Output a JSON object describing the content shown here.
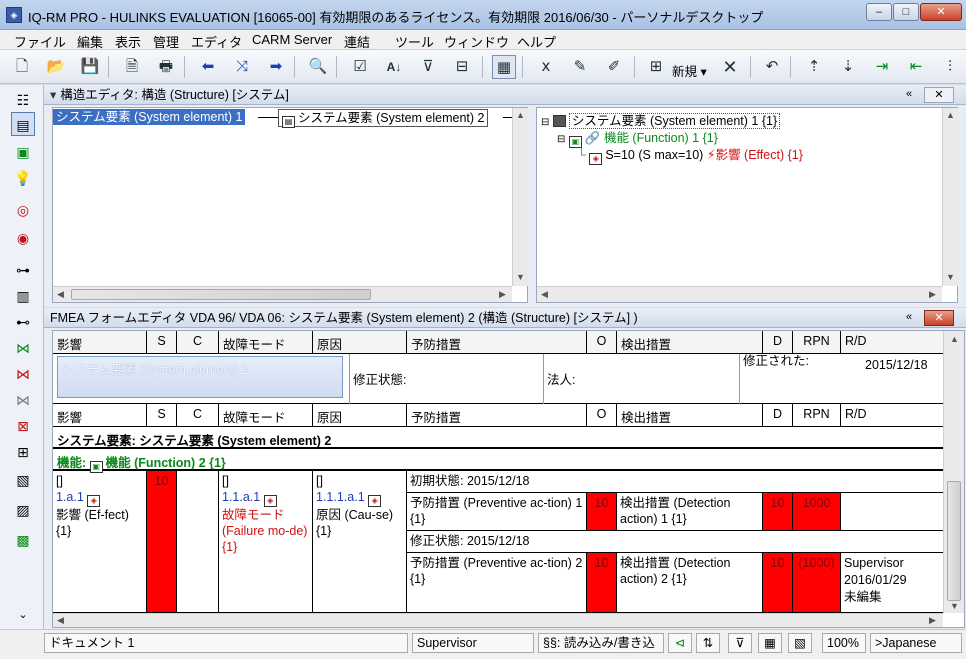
{
  "window": {
    "title": "IQ-RM PRO - HULINKS EVALUATION [16065-00] 有効期限のあるライセンス。有効期限 2016/06/30 - パーソナルデスクトップ",
    "minimize": "–",
    "maximize": "□",
    "close": "✕"
  },
  "menu": [
    "ファイル",
    "編集",
    "表示",
    "管理",
    "エディタ",
    "CARM Server",
    "連結",
    "ツール",
    "ウィンドウ",
    "ヘルプ"
  ],
  "toolbar": {
    "new_label": "新規"
  },
  "structure_editor": {
    "title": "構造エディタ: 構造 (Structure) [システム]",
    "node_selected": "システム要素 (System element) 1",
    "node_child": "システム要素 (System element) 2",
    "tree": {
      "root": "システム要素 (System element) 1 {1}",
      "function": "機能 (Function) 1 {1}",
      "effect_rating": "S=10 (S max=10)",
      "effect": "影響 (Effect) {1}"
    }
  },
  "fmea": {
    "title": "FMEA フォームエディタ VDA 96/ VDA 06: システム要素 (System element) 2 (構造 (Structure) [システム] )",
    "headers": [
      "影響",
      "S",
      "C",
      "故障モード",
      "原因",
      "予防措置",
      "O",
      "検出措置",
      "D",
      "RPN",
      "R/D"
    ],
    "form": {
      "element_box": "システム要素 (System element) 2",
      "revision_state": "修正状態:",
      "legal_entity": "法人:",
      "modified_label": "修正された:",
      "modified_date": "2015/12/18"
    },
    "system_element_row": "システム要素: システム要素 (System element) 2",
    "function_row_prefix": "機能:",
    "function_row": "機能 (Function) 2 {1}",
    "effect": {
      "bracket": "[]",
      "id": "1.a.1",
      "text": "影響 (Ef-fect) {1}"
    },
    "severity": "10",
    "failure": {
      "bracket": "[]",
      "id": "1.1.a.1",
      "text": "故障モード (Failure mo-de) {1}"
    },
    "cause": {
      "bracket": "[]",
      "id": "1.1.1.a.1",
      "text": "原因 (Cau-se) {1}"
    },
    "initial_state": "初期状態: 2015/12/18",
    "prevent1": "予防措置 (Preventive ac-tion) 1 {1}",
    "o1": "10",
    "detect1": "検出措置 (Detection action) 1 {1}",
    "d1": "10",
    "rpn1": "1000",
    "revised_state": "修正状態: 2015/12/18",
    "prevent2": "予防措置 (Preventive ac-tion) 2 {1}",
    "o2": "10",
    "detect2": "検出措置 (Detection action) 2 {1}",
    "d2": "10",
    "rpn2": "(1000)",
    "rd_name": "Supervisor",
    "rd_date": "2016/01/29",
    "rd_status": "未編集"
  },
  "status": {
    "document": "ドキュメント 1",
    "user": "Supervisor",
    "mode": "§§: 読み込み/書き込",
    "zoom": "100%",
    "language": ">Japanese"
  },
  "colors": {
    "severity_red": "#ff0000",
    "function_green": "#0a8a1a",
    "failure_red": "#d01010",
    "id_blue": "#1a3fb8"
  }
}
